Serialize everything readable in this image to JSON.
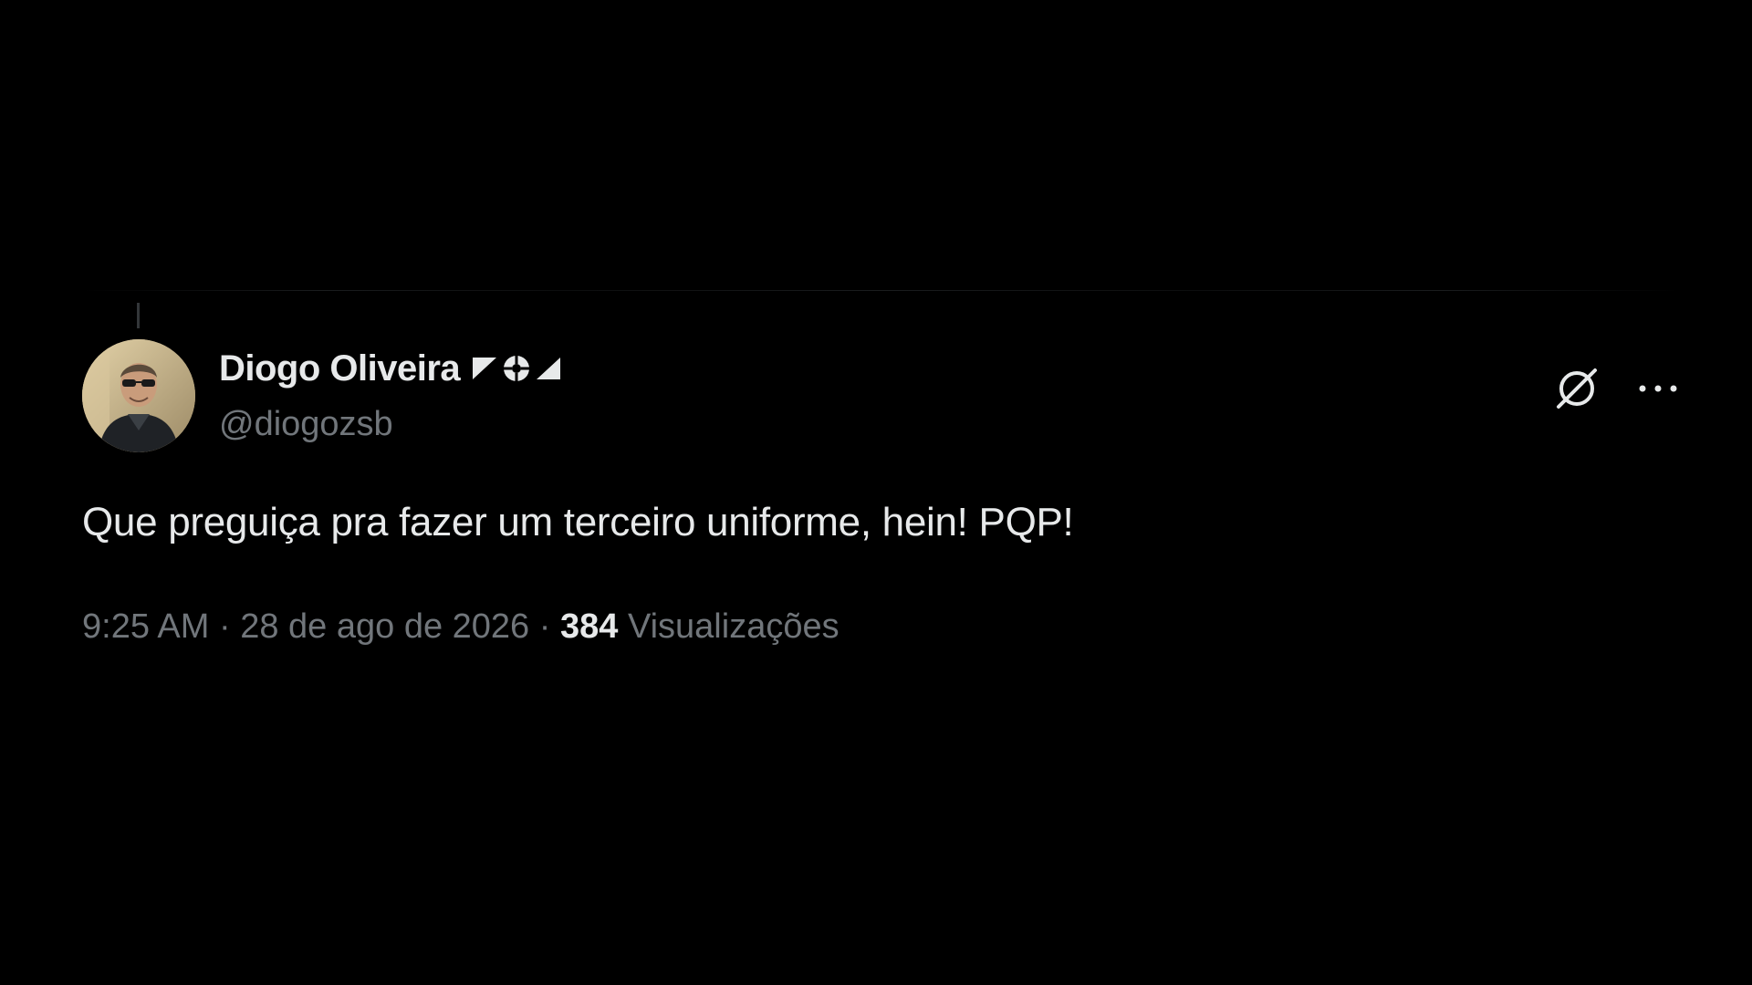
{
  "tweet": {
    "author": {
      "display_name": "Diogo Oliveira",
      "handle": "@diogozsb",
      "avatar": "profile-photo",
      "badges": [
        "flag-corner-left-icon",
        "ball-icon",
        "flag-corner-right-icon"
      ]
    },
    "actions": {
      "grok_icon": "grok-icon",
      "more_icon": "more-horizontal-icon"
    },
    "text": "Que preguiça pra fazer um terceiro uniforme, hein! PQP!",
    "meta": {
      "time": "9:25 AM",
      "separator": "·",
      "date": "28 de ago de 2026",
      "views_count": "384",
      "views_label": "Visualizações"
    }
  },
  "colors": {
    "background": "#000000",
    "primary_text": "#e7e9ea",
    "secondary_text": "#71767b"
  }
}
